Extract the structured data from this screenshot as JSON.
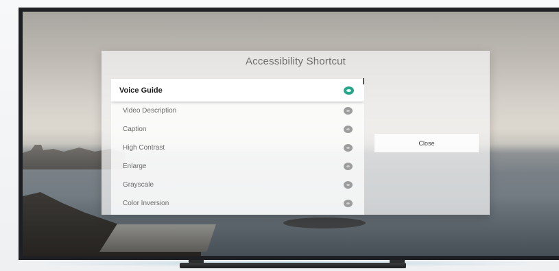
{
  "dialog": {
    "title": "Accessibility Shortcut",
    "close_label": "Close"
  },
  "shortcuts": [
    {
      "label": "Voice Guide",
      "enabled": true,
      "focused": true
    },
    {
      "label": "Video Description",
      "enabled": false,
      "focused": false
    },
    {
      "label": "Caption",
      "enabled": false,
      "focused": false
    },
    {
      "label": "High Contrast",
      "enabled": false,
      "focused": false
    },
    {
      "label": "Enlarge",
      "enabled": false,
      "focused": false
    },
    {
      "label": "Grayscale",
      "enabled": false,
      "focused": false
    },
    {
      "label": "Color Inversion",
      "enabled": false,
      "focused": false
    }
  ],
  "colors": {
    "toggle_on": "#26a68a",
    "toggle_off": "#9d9d9d"
  }
}
